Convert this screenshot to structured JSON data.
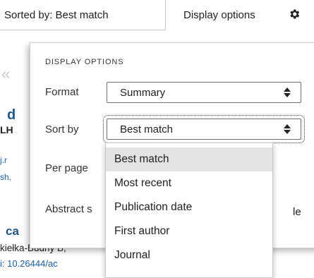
{
  "topbar": {
    "sorted_text": "Sorted by: Best match",
    "display_options_label": "Display options"
  },
  "background": {
    "chevron": "«",
    "frag_d": "d",
    "frag_lh": "LH",
    "frag_jr": "j.r",
    "frag_sh": "sh,",
    "frag_ca": "ca",
    "author_text": "kiełka-Budny B,",
    "doi_text": "i: 10.26444/ac"
  },
  "panel": {
    "heading": "DISPLAY OPTIONS",
    "format": {
      "label": "Format",
      "value": "Summary"
    },
    "sort_by": {
      "label": "Sort by",
      "value": "Best match"
    },
    "per_page": {
      "label": "Per page"
    },
    "abstract": {
      "label": "Abstract s",
      "trailing": "le"
    }
  },
  "sort_options": [
    "Best match",
    "Most recent",
    "Publication date",
    "First author",
    "Journal"
  ],
  "selected_sort": "Best match",
  "colors": {
    "link": "#1a5fa8",
    "selected_option_bg": "#e3e3e3",
    "border": "#6f6f6f"
  }
}
